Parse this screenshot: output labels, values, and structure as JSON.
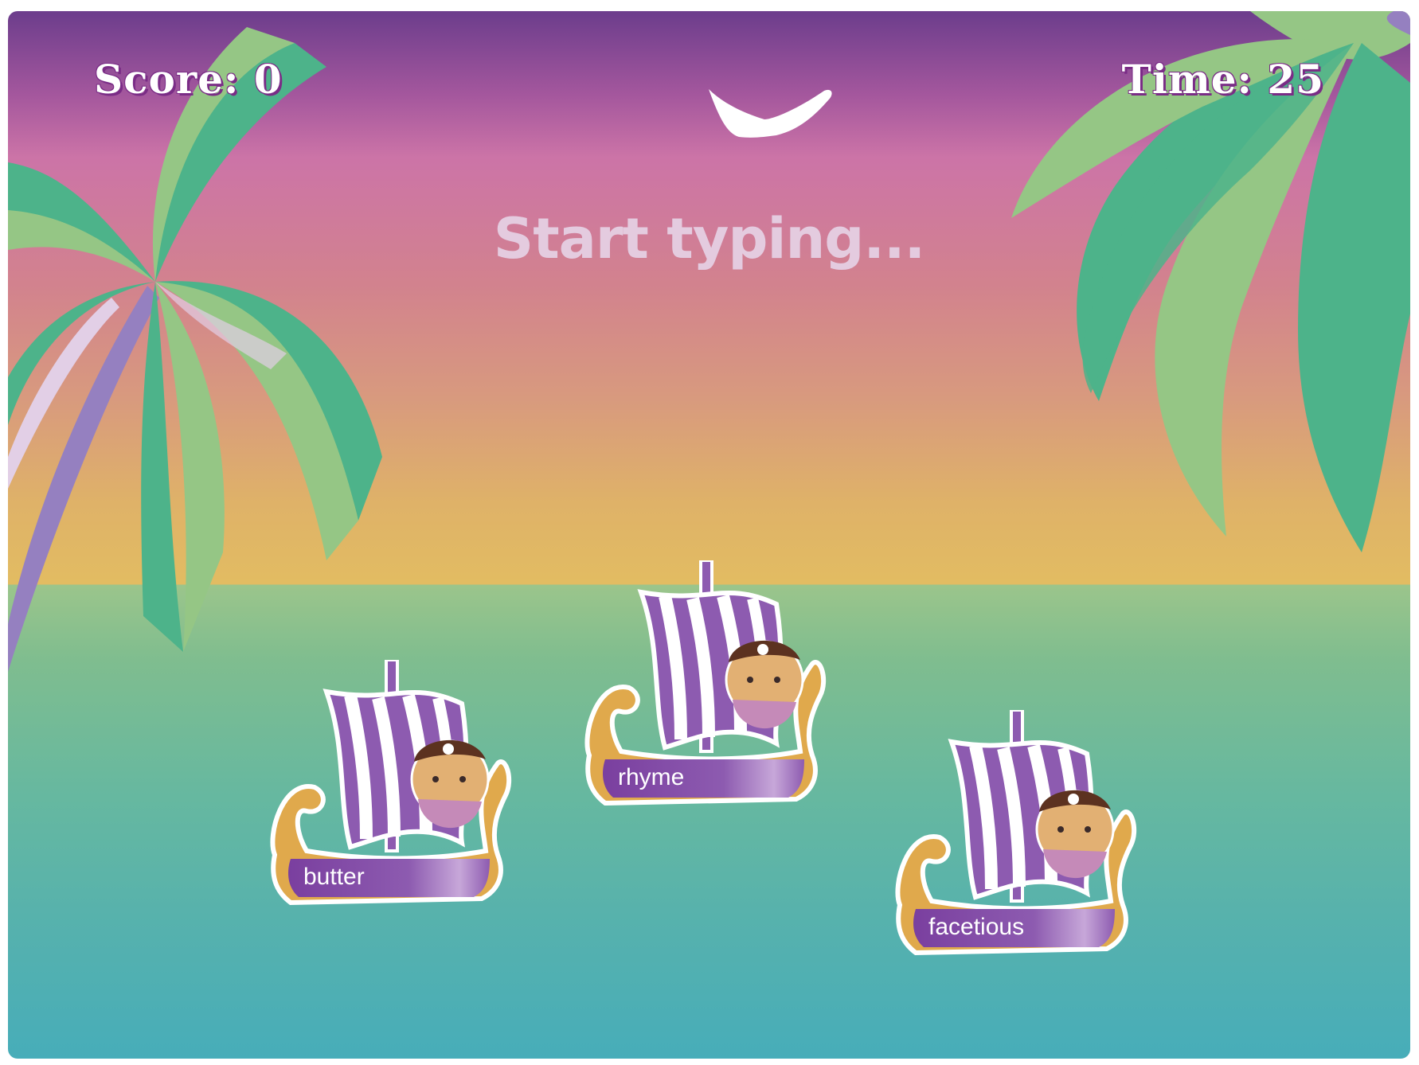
{
  "hud": {
    "score_label": "Score: 0",
    "time_label": "Time: 25"
  },
  "prompt": "Start typing...",
  "ships": [
    {
      "word": "butter"
    },
    {
      "word": "rhyme"
    },
    {
      "word": "facetious"
    }
  ],
  "colors": {
    "sky_top": "#6c3d8c",
    "sky_mid": "#cc74a7",
    "horizon": "#e2bc62",
    "sea_top": "#9bc58b",
    "sea_bottom": "#47adb9",
    "palm_dark": "#4db38a",
    "palm_light": "#95c685",
    "trunk": "#9580c0",
    "sail_purple": "#8d5bb0",
    "hull_gold": "#e0a94c"
  }
}
